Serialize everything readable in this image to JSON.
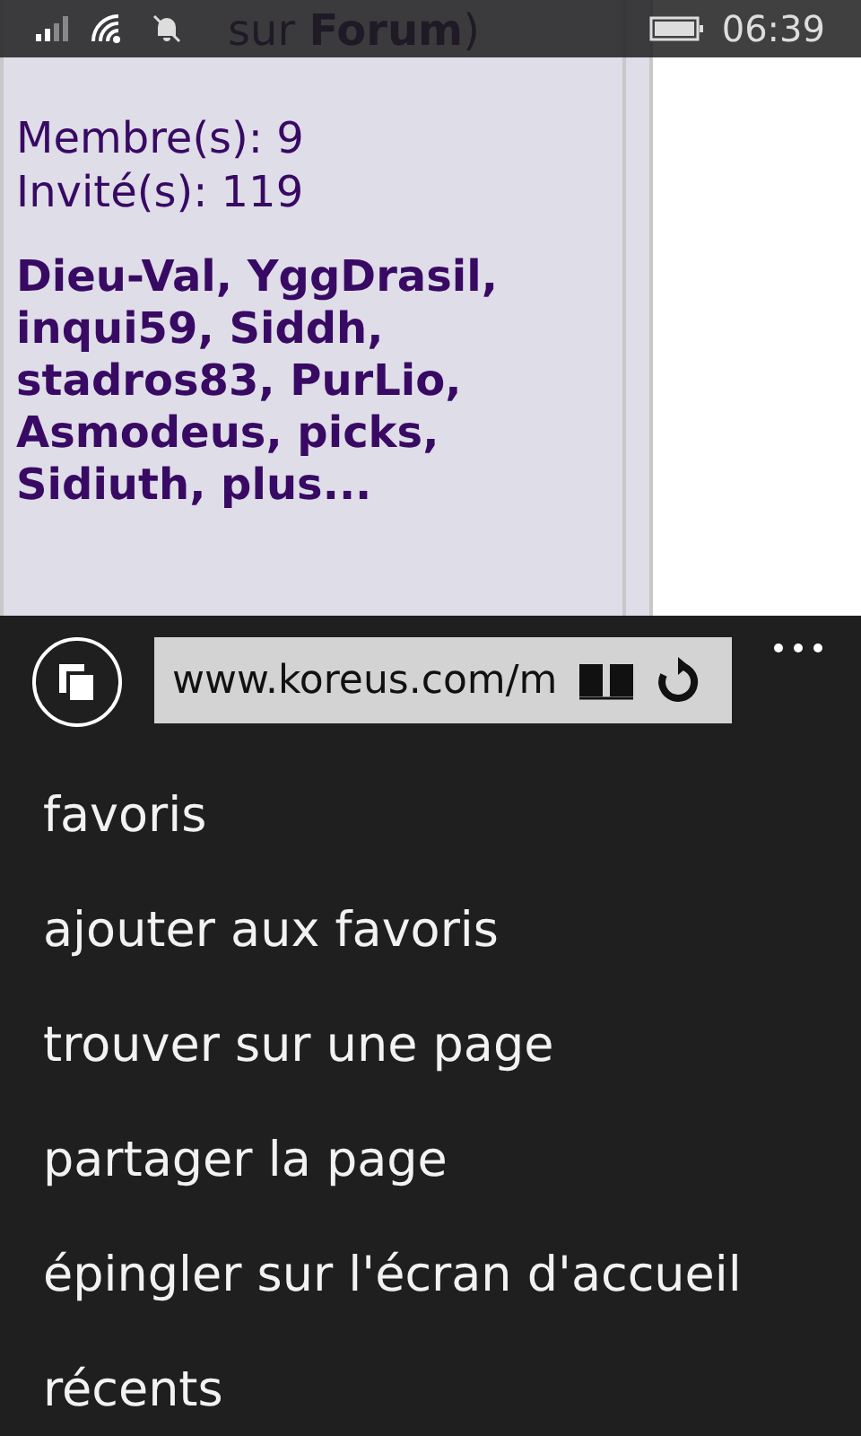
{
  "status_bar": {
    "time": "06:39"
  },
  "page": {
    "header_line": "sur **Forum**)",
    "members": "Membre(s): 9",
    "guests": "Invité(s): 119",
    "online_names": "Dieu-Val, YggDrasil, inqui59, Siddh, stadros83, PurLio, Asmodeus, picks, Sidiuth, plus..."
  },
  "address_bar": {
    "url": "www.koreus.com/m"
  },
  "menu": [
    "favoris",
    "ajouter aux favoris",
    "trouver sur une page",
    "partager la page",
    "épingler sur l'écran d'accueil",
    "récents"
  ]
}
